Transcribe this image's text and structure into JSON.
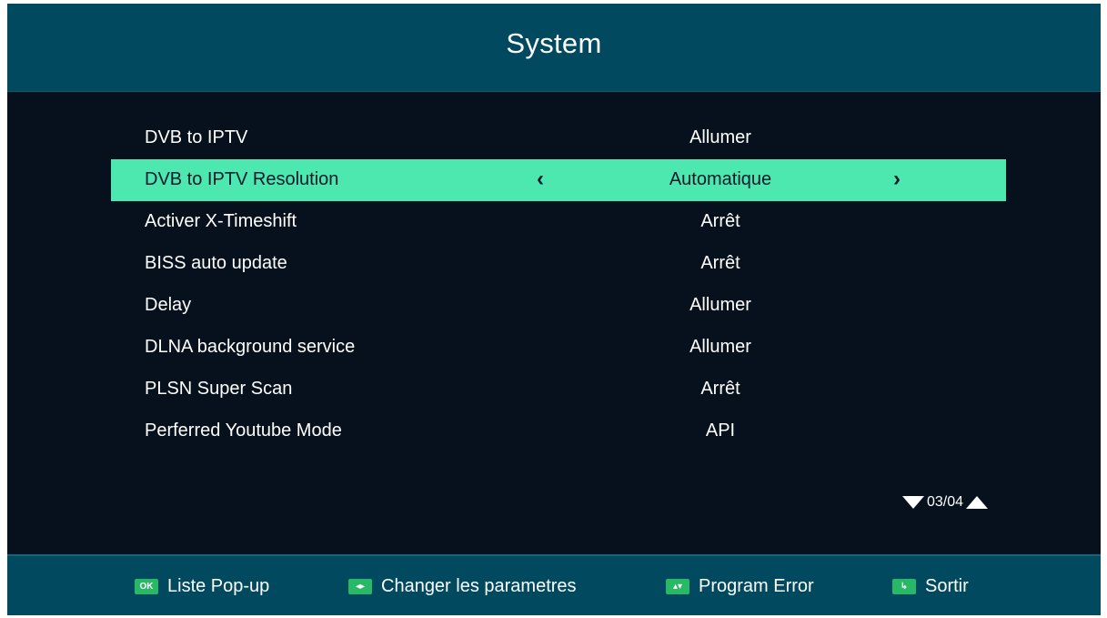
{
  "header": {
    "title": "System"
  },
  "menu": {
    "items": [
      {
        "label": "DVB to IPTV",
        "value": "Allumer"
      },
      {
        "label": "DVB to IPTV Resolution",
        "value": "Automatique"
      },
      {
        "label": "Activer X-Timeshift",
        "value": "Arrêt"
      },
      {
        "label": "BISS auto update",
        "value": "Arrêt"
      },
      {
        "label": "Delay",
        "value": "Allumer"
      },
      {
        "label": "DLNA background service",
        "value": "Allumer"
      },
      {
        "label": "PLSN Super Scan",
        "value": "Arrêt"
      },
      {
        "label": "Perferred Youtube Mode",
        "value": "API"
      }
    ],
    "selected_index": 1,
    "left_arrow": "‹",
    "right_arrow": "›"
  },
  "pager": {
    "text": "03/04"
  },
  "footer": {
    "hints": [
      {
        "key": "OK",
        "label": "Liste Pop-up",
        "icon": "ok-key-icon"
      },
      {
        "key": "◂▸",
        "label": "Changer les parametres",
        "icon": "left-right-key-icon"
      },
      {
        "key": "▴▾",
        "label": "Program Error",
        "icon": "up-down-key-icon"
      },
      {
        "key": "↳",
        "label": "Sortir",
        "icon": "exit-key-icon"
      }
    ]
  },
  "colors": {
    "background": "#06111d",
    "header_bar": "#01495f",
    "selection": "#4de8b0",
    "key_badge": "#29b865"
  }
}
